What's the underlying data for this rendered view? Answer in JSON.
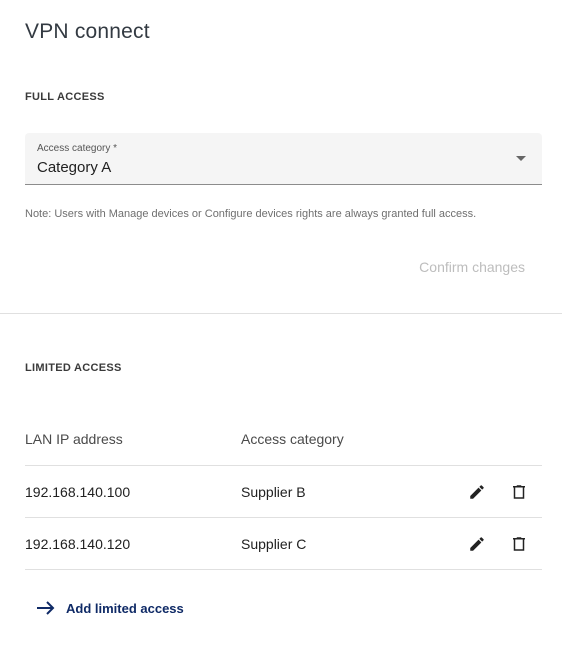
{
  "page": {
    "title": "VPN connect"
  },
  "full_access": {
    "title": "FULL ACCESS",
    "select": {
      "label": "Access category *",
      "value": "Category A"
    },
    "note": "Note: Users with Manage devices or Configure devices rights are always granted full access.",
    "confirm_label": "Confirm changes"
  },
  "limited_access": {
    "title": "LIMITED ACCESS",
    "columns": [
      "LAN IP address",
      "Access category"
    ],
    "rows": [
      {
        "ip": "192.168.140.100",
        "category": "Supplier B"
      },
      {
        "ip": "192.168.140.120",
        "category": "Supplier C"
      }
    ],
    "add_label": "Add limited access"
  },
  "colors": {
    "link": "#0f2a66",
    "disabled_text": "#bdbdbd",
    "field_bg": "#f5f5f5"
  },
  "icons": [
    "chevron-down-icon",
    "edit-icon",
    "delete-icon",
    "arrow-right-icon"
  ]
}
